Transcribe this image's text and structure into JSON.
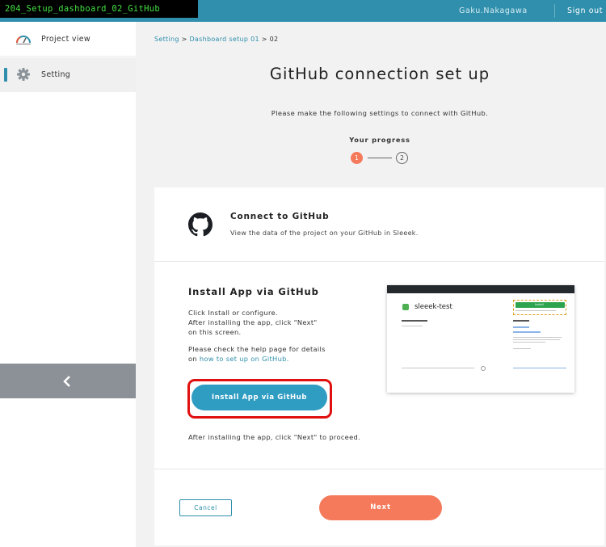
{
  "window": {
    "title": "204_Setup_dashboard_02_GitHub"
  },
  "header": {
    "user_name": "Gaku.Nakagawa",
    "sign_out": "Sign out"
  },
  "sidebar": {
    "items": [
      {
        "label": "Project view",
        "icon": "gauge-icon"
      },
      {
        "label": "Setting",
        "icon": "gear-icon",
        "active": true
      }
    ],
    "collapse_icon": "chevron-left-icon"
  },
  "breadcrumb": {
    "items": [
      "Setting",
      "Dashboard setup 01",
      "02"
    ],
    "separator": ">"
  },
  "main": {
    "title": "GitHub connection set up",
    "instruction": "Please make the following settings to connect with GitHub.",
    "progress": {
      "label": "Your progress",
      "steps": [
        "1",
        "2"
      ],
      "current": 1
    }
  },
  "connect": {
    "title": "Connect to GitHub",
    "subtitle": "View the data of the project on your GitHub in Sleeek."
  },
  "install": {
    "title": "Install App via GitHub",
    "desc_line1": "Click Install or configure.",
    "desc_line2": "After installing the app, click \"Next\"",
    "desc_line3": "on this screen.",
    "help_prefix": "Please check the help page for details",
    "help_on": "on",
    "help_link": "how to set up on GitHub.",
    "button": "Install App via GitHub",
    "after_note": "After installing the app, click \"Next\" to proceed."
  },
  "preview": {
    "repo_name": "sleeek-test",
    "install_label": "Install"
  },
  "footer": {
    "cancel": "Cancel",
    "next": "Next"
  },
  "colors": {
    "accent": "#2f8fac",
    "primary_orange": "#f47a5b",
    "install_blue": "#2f9cc2",
    "highlight_red": "#e01010"
  }
}
